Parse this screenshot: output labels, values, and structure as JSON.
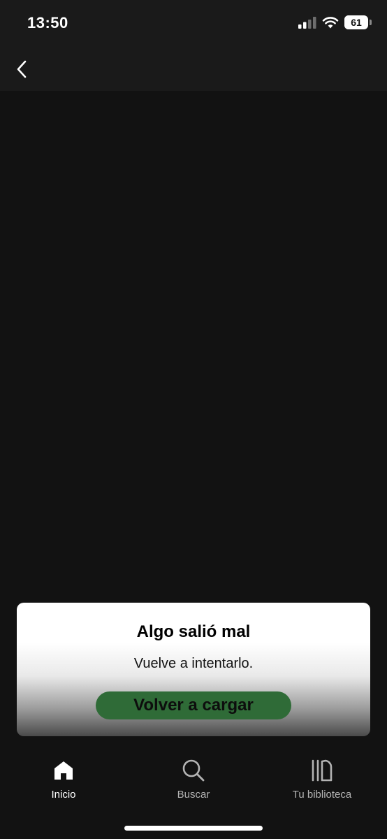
{
  "status_bar": {
    "time": "13:50",
    "battery_level": "61",
    "battery_percent": 61,
    "signal_bars_active": 2,
    "signal_bars_total": 4,
    "icons": [
      "cellular-signal-icon",
      "wifi-icon",
      "battery-icon"
    ]
  },
  "header": {
    "back_icon": "chevron-left-icon"
  },
  "error": {
    "title": "Algo salió mal",
    "message": "Vuelve a intentarlo.",
    "reload_label": "Volver a cargar"
  },
  "tabs": [
    {
      "label": "Inicio",
      "icon": "home-icon",
      "active": true
    },
    {
      "label": "Buscar",
      "icon": "search-icon",
      "active": false
    },
    {
      "label": "Tu biblioteca",
      "icon": "library-icon",
      "active": false
    }
  ],
  "colors": {
    "background": "#121212",
    "header": "#1a1a1a",
    "accent_green": "#2f6b37",
    "tab_active": "#ffffff",
    "tab_inactive": "#b3b3b3"
  }
}
